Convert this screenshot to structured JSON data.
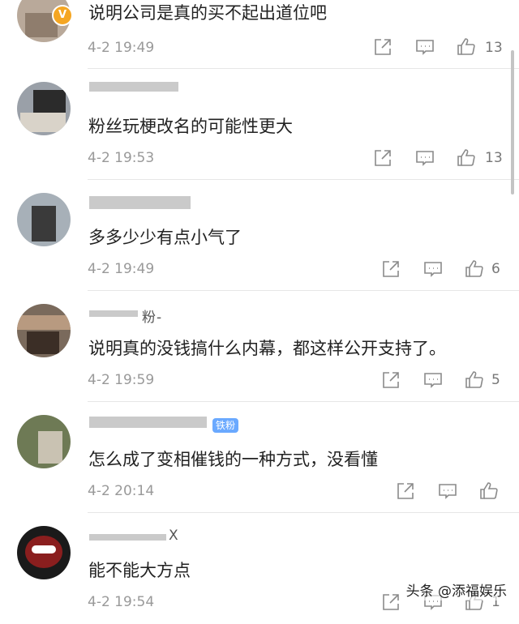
{
  "comments": [
    {
      "name": "",
      "text": "说明公司是真的买不起出道位吧",
      "time": "4-2 19:49",
      "likes": "13",
      "verified": "V"
    },
    {
      "name": "",
      "text": "粉丝玩梗改名的可能性更大",
      "time": "4-2 19:53",
      "likes": "13"
    },
    {
      "name": "",
      "text": "多多少少有点小气了",
      "time": "4-2 19:49",
      "likes": "6"
    },
    {
      "name": "粉-",
      "text": "说明真的没钱搞什么内幕，都这样公开支持了。",
      "time": "4-2 19:59",
      "likes": "5"
    },
    {
      "name": "",
      "badge": "铁粉",
      "text": "怎么成了变相催钱的一种方式，没看懂",
      "time": "4-2 20:14",
      "likes": ""
    },
    {
      "name": "X",
      "text": "能不能大方点",
      "time": "4-2 19:54",
      "likes": "1"
    }
  ],
  "watermark": "头条 @添福娱乐",
  "colors": {
    "icon": "#8a8a8a",
    "text": "#222222",
    "meta": "#999999",
    "badge": "#6aa9ff",
    "verified": "#f5a623"
  }
}
